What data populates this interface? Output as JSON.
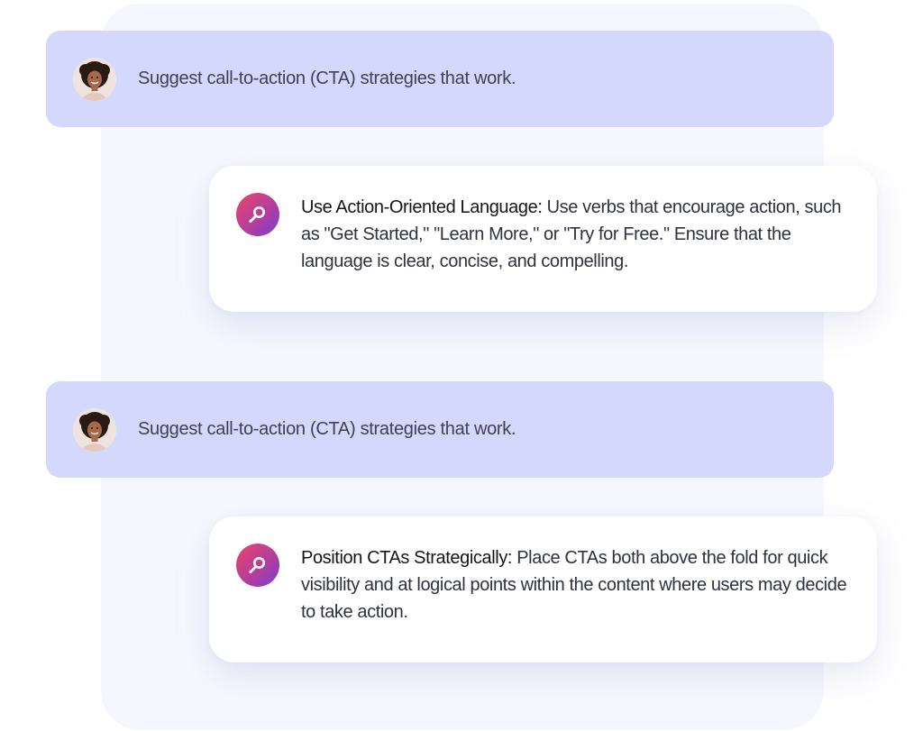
{
  "conversation": [
    {
      "role": "user",
      "avatar": "user-avatar-photo",
      "text": "Suggest call-to-action (CTA) strategies that work."
    },
    {
      "role": "assistant",
      "icon": "assistant-logo-icon",
      "lead": "Use Action-Oriented Language:",
      "text": " Use verbs that encourage action, such as \"Get Started,\" \"Learn More,\" or \"Try for Free.\" Ensure that the language is clear, concise, and compelling."
    },
    {
      "role": "user",
      "avatar": "user-avatar-photo",
      "text": "Suggest call-to-action (CTA) strategies that work."
    },
    {
      "role": "assistant",
      "icon": "assistant-logo-icon",
      "lead": "Position CTAs Strategically:",
      "text": " Place CTAs both above the fold for quick visibility and at logical points within the content where users may decide to take action."
    }
  ],
  "colors": {
    "user_bubble": "#d5d8fd",
    "backdrop": "#f6f7fe",
    "assistant_bubble": "#ffffff",
    "icon_gradient_start": "#e8456b",
    "icon_gradient_end": "#7b3fd0"
  }
}
